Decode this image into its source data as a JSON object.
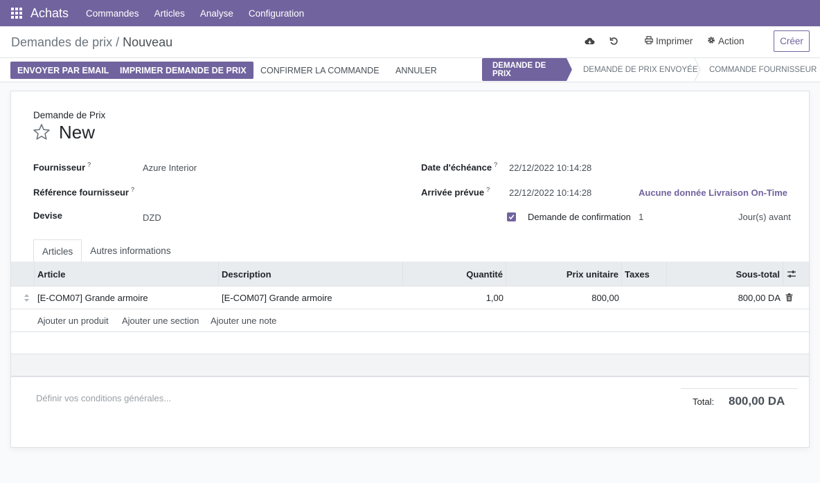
{
  "navbar": {
    "app_name": "Achats",
    "menu": [
      "Commandes",
      "Articles",
      "Analyse",
      "Configuration"
    ]
  },
  "control": {
    "breadcrumb_parent": "Demandes de prix",
    "breadcrumb_sep": " / ",
    "breadcrumb_current": "Nouveau",
    "print_label": "Imprimer",
    "action_label": "Action",
    "create_label": "Créer"
  },
  "actions": {
    "send_email": "ENVOYER PAR EMAIL",
    "print_rfq": "IMPRIMER DEMANDE DE PRIX",
    "confirm_order": "CONFIRMER LA COMMANDE",
    "cancel": "ANNULER"
  },
  "status": {
    "steps": [
      "DEMANDE DE PRIX",
      "DEMANDE DE PRIX ENVOYÉE",
      "COMMANDE FOURNISSEUR"
    ],
    "active_index": 0
  },
  "form": {
    "doc_label": "Demande de Prix",
    "title": "New",
    "left_fields": [
      {
        "label": "Fournisseur",
        "help": "?",
        "value": "Azure Interior"
      },
      {
        "label": "Référence fournisseur",
        "help": "?",
        "value": ""
      },
      {
        "label": "Devise",
        "help": "",
        "value": "DZD"
      }
    ],
    "right_fields": [
      {
        "label": "Date d'échéance",
        "help": "?",
        "value": "22/12/2022 10:14:28"
      },
      {
        "label": "Arrivée prévue",
        "help": "?",
        "value": "22/12/2022 10:14:28",
        "link": "Aucune donnée Livraison On-Time"
      }
    ],
    "confirmation": {
      "checked": true,
      "label": "Demande de confirmation",
      "days": "1",
      "suffix": "Jour(s) avant"
    }
  },
  "tabs": [
    "Articles",
    "Autres informations"
  ],
  "table": {
    "columns": [
      "Article",
      "Description",
      "Quantité",
      "Prix unitaire",
      "Taxes",
      "Sous-total"
    ],
    "rows": [
      {
        "article": "[E-COM07] Grande armoire",
        "description": "[E-COM07] Grande armoire",
        "qty": "1,00",
        "price": "800,00",
        "taxes": "",
        "subtotal": "800,00 DA"
      }
    ],
    "add_links": [
      "Ajouter un produit",
      "Ajouter une section",
      "Ajouter une note"
    ]
  },
  "footer": {
    "terms_placeholder": "Définir vos conditions générales...",
    "total_label": "Total:",
    "total_value": "800,00 DA"
  },
  "colors": {
    "brand": "#71639e"
  }
}
